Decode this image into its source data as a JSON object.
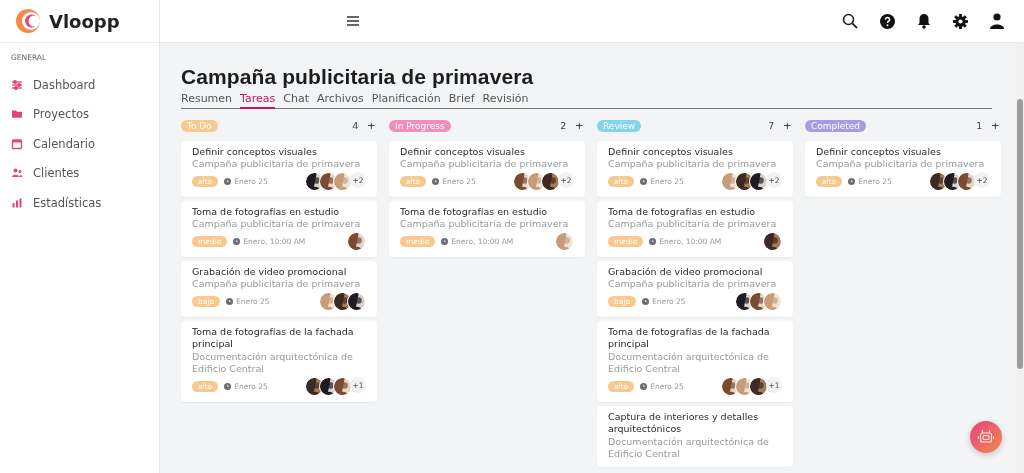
{
  "brand": {
    "name": "Vloopp"
  },
  "sidebar": {
    "section": "GENERAL",
    "items": [
      {
        "label": "Dashboard",
        "kind": "sliders"
      },
      {
        "label": "Proyectos",
        "kind": "folder"
      },
      {
        "label": "Calendario",
        "kind": "calendar"
      },
      {
        "label": "Clientes",
        "kind": "users"
      },
      {
        "label": "Estadísticas",
        "kind": "chart"
      }
    ]
  },
  "page": {
    "title": "Campaña publicitaria de primavera"
  },
  "tabs": [
    {
      "label": "Resumen",
      "selected": false
    },
    {
      "label": "Tareas",
      "selected": true
    },
    {
      "label": "Chat",
      "selected": false
    },
    {
      "label": "Archivos",
      "selected": false
    },
    {
      "label": "Planificación",
      "selected": false
    },
    {
      "label": "Brief",
      "selected": false
    },
    {
      "label": "Revisión",
      "selected": false
    }
  ],
  "columns": [
    {
      "name": "To Do",
      "color": "#f8c88e",
      "count": "4",
      "add": "+",
      "cards": [
        {
          "title": "Definir conceptos visuales",
          "subtitle": "Campaña publicitaria de primavera",
          "priority": "alto",
          "date": "Enero 25",
          "extra": "+2"
        },
        {
          "title": "Toma de fotografías en estudio",
          "subtitle": "Campaña publicitaria de primavera",
          "priority": "medio",
          "date": "Enero, 10:00 AM"
        },
        {
          "title": "Grabación de video promocional",
          "subtitle": "Campaña publicitaria de primavera",
          "priority": "bajo",
          "date": "Enero 25"
        },
        {
          "title": "Toma de fotografías de la fachada principal",
          "subtitle": "Documentación arquitectónica de Edificio Central",
          "priority": "alto",
          "date": "Enero 25",
          "extra": "+1"
        }
      ]
    },
    {
      "name": "In Progress",
      "color": "#f08fba",
      "count": "2",
      "add": "+",
      "cards": [
        {
          "title": "Definir conceptos visuales",
          "subtitle": "Campaña publicitaria de primavera",
          "priority": "alto",
          "date": "Enero 25",
          "extra": "+2"
        },
        {
          "title": "Toma de fotografías en estudio",
          "subtitle": "Campaña publicitaria de primavera",
          "priority": "medio",
          "date": "Enero, 10:00 AM"
        }
      ]
    },
    {
      "name": "Review",
      "color": "#84d4ec",
      "count": "7",
      "add": "+",
      "cards": [
        {
          "title": "Definir conceptos visuales",
          "subtitle": "Campaña publicitaria de primavera",
          "priority": "alto",
          "date": "Enero 25",
          "extra": "+2"
        },
        {
          "title": "Toma de fotografías en estudio",
          "subtitle": "Campaña publicitaria de primavera",
          "priority": "medio",
          "date": "Enero, 10:00 AM"
        },
        {
          "title": "Grabación de video promocional",
          "subtitle": "Campaña publicitaria de primavera",
          "priority": "bajo",
          "date": "Enero 25"
        },
        {
          "title": "Toma de fotografías de la fachada principal",
          "subtitle": "Documentación arquitectónica de Edificio Central",
          "priority": "alto",
          "date": "Enero 25",
          "extra": "+1"
        },
        {
          "title": "Captura de interiores y detalles arquitectónicos",
          "subtitle": "Documentación arquitectónica de Edificio Central"
        }
      ]
    },
    {
      "name": "Completed",
      "color": "#a89be6",
      "count": "1",
      "add": "+",
      "cards": [
        {
          "title": "Definir conceptos visuales",
          "subtitle": "Campaña publicitaria de primavera",
          "priority": "alto",
          "date": "Enero 25",
          "extra": "+2"
        }
      ]
    }
  ]
}
